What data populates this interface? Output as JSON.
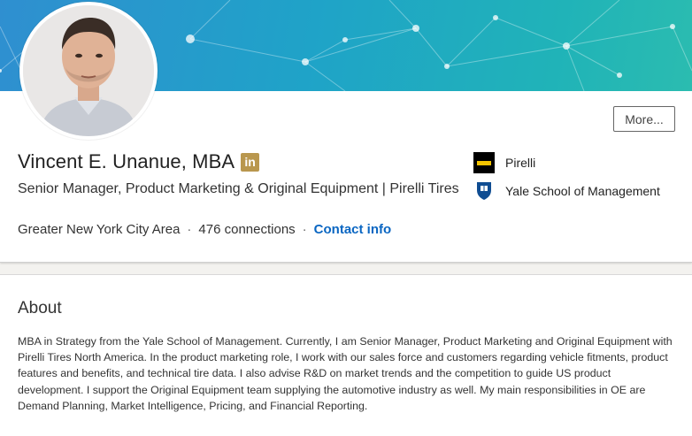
{
  "profile": {
    "name": "Vincent E. Unanue, MBA",
    "badge": "in",
    "headline": "Senior Manager, Product Marketing & Original Equipment | Pirelli Tires",
    "location": "Greater New York City Area",
    "separator": "·",
    "connections": "476 connections",
    "contact_label": "Contact info",
    "more_label": "More..."
  },
  "experience": {
    "company": "Pirelli",
    "company_icon": "pirelli-logo-icon"
  },
  "education": {
    "school": "Yale School of Management",
    "school_icon": "yale-shield-icon"
  },
  "about": {
    "title": "About",
    "text": "MBA in Strategy from the Yale School of Management. Currently, I am Senior Manager, Product Marketing and Original Equipment with Pirelli Tires North America. In the product marketing role, I work with our sales force and customers regarding vehicle fitments, product features and benefits, and technical tire data. I also advise R&D on market trends and the competition to guide US product development. I support the Original Equipment team supplying the automotive industry as well. My main responsibilities in OE are Demand Planning, Market Intelligence, Pricing, and Financial Reporting."
  },
  "colors": {
    "banner_start": "#2f8fd0",
    "banner_end": "#2bbcb0",
    "link": "#0a66c2",
    "badge": "#b9974e",
    "pirelli_yellow": "#f5c400",
    "yale_blue": "#0f4d92"
  }
}
